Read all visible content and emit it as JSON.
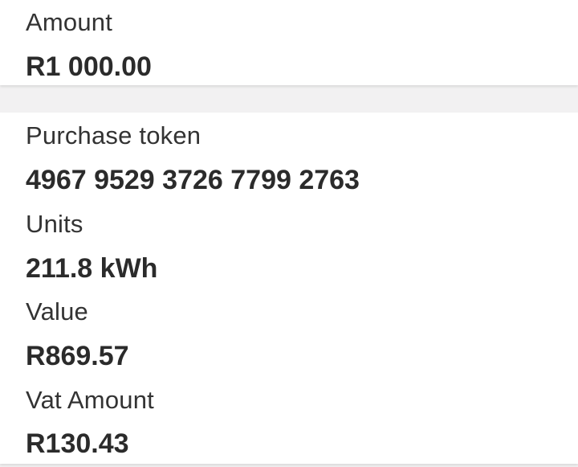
{
  "amount": {
    "label": "Amount",
    "value": "R1 000.00"
  },
  "details": {
    "purchase_token": {
      "label": "Purchase token",
      "value": "4967 9529 3726 7799 2763"
    },
    "units": {
      "label": "Units",
      "value": "211.8 kWh"
    },
    "value": {
      "label": "Value",
      "value": "R869.57"
    },
    "vat_amount": {
      "label": "Vat Amount",
      "value": "R130.43"
    }
  }
}
